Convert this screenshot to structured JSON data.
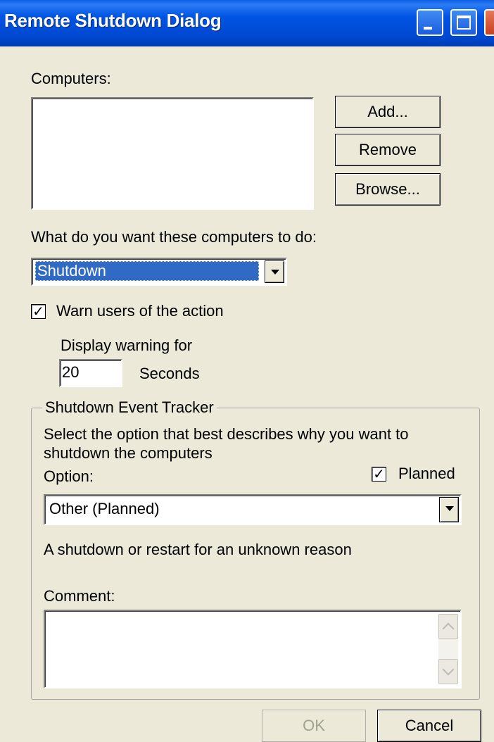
{
  "window": {
    "title": "Remote Shutdown Dialog"
  },
  "computers": {
    "label": "Computers:",
    "items": [],
    "add_label": "Add...",
    "remove_label": "Remove",
    "browse_label": "Browse..."
  },
  "action": {
    "label": "What do you want these computers to do:",
    "selected": "Shutdown"
  },
  "warning": {
    "warn_label": "Warn users of the action",
    "warn_checked": true,
    "display_label": "Display warning for",
    "seconds_value": "20",
    "seconds_label": "Seconds"
  },
  "tracker": {
    "legend": "Shutdown Event Tracker",
    "description": "Select the option that best describes why you want to shutdown the computers",
    "option_label": "Option:",
    "planned_label": "Planned",
    "planned_checked": true,
    "option_selected": "Other (Planned)",
    "reason_text": "A shutdown or restart for an unknown reason",
    "comment_label": "Comment:",
    "comment_value": ""
  },
  "footer": {
    "ok_label": "OK",
    "ok_enabled": false,
    "cancel_label": "Cancel"
  }
}
